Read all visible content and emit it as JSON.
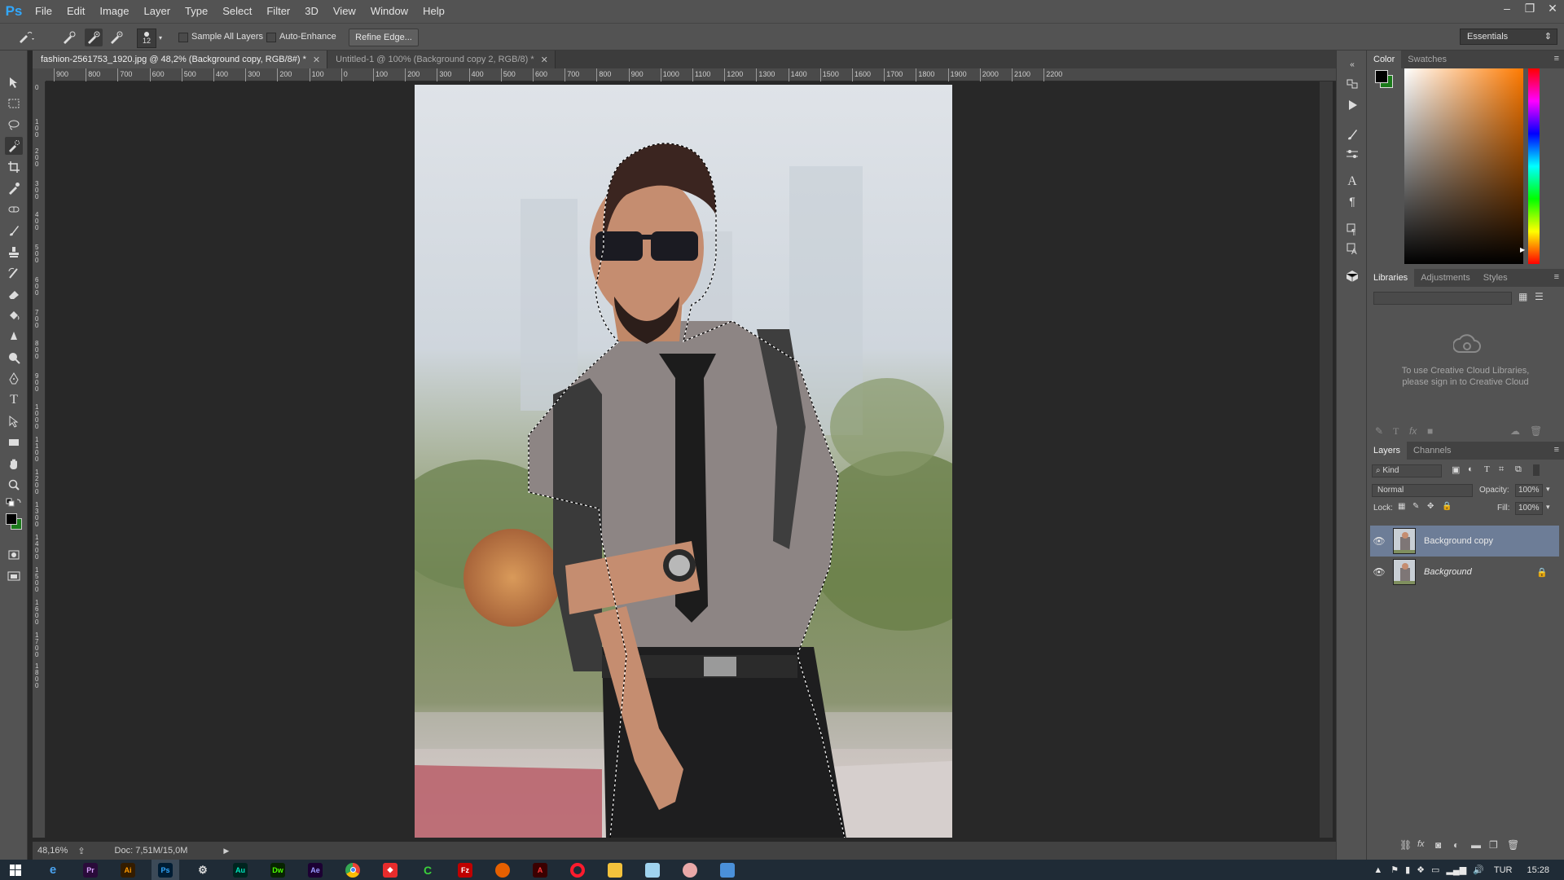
{
  "app": {
    "logo_text": "Ps",
    "menu": [
      "File",
      "Edit",
      "Image",
      "Layer",
      "Type",
      "Select",
      "Filter",
      "3D",
      "View",
      "Window",
      "Help"
    ],
    "window_controls": [
      "–",
      "❐",
      "✕"
    ]
  },
  "options_bar": {
    "brush_size": "12",
    "sample_all_layers_label": "Sample All Layers",
    "auto_enhance_label": "Auto-Enhance",
    "refine_edge_label": "Refine Edge...",
    "workspace": "Essentials"
  },
  "documents": [
    {
      "title": "fashion-2561753_1920.jpg @ 48,2% (Background copy, RGB/8#) *",
      "active": true
    },
    {
      "title": "Untitled-1 @ 100% (Background copy 2, RGB/8) *",
      "active": false
    }
  ],
  "ruler": {
    "top_labels": [
      "900",
      "800",
      "700",
      "600",
      "500",
      "400",
      "300",
      "200",
      "100",
      "0",
      "100",
      "200",
      "300",
      "400",
      "500",
      "600",
      "700",
      "800",
      "900",
      "1000",
      "1100",
      "1200",
      "1300",
      "1400",
      "1500",
      "1600",
      "1700",
      "1800",
      "1900",
      "2000",
      "2100",
      "2200"
    ]
  },
  "status": {
    "zoom": "48,16%",
    "doc_size": "Doc: 7,51M/15,0M"
  },
  "color_panel": {
    "tabs": [
      "Color",
      "Swatches"
    ],
    "foreground": "#000000",
    "background": "#1a7a1a"
  },
  "libraries_panel": {
    "tabs": [
      "Libraries",
      "Adjustments",
      "Styles"
    ],
    "message_line1": "To use Creative Cloud Libraries,",
    "message_line2": "please sign in to Creative Cloud"
  },
  "layers_panel": {
    "tabs": [
      "Layers",
      "Channels"
    ],
    "filter_kind": "Kind",
    "blend_mode": "Normal",
    "opacity_label": "Opacity:",
    "opacity_value": "100%",
    "lock_label": "Lock:",
    "fill_label": "Fill:",
    "fill_value": "100%",
    "layers": [
      {
        "name": "Background copy",
        "selected": true,
        "locked": false
      },
      {
        "name": "Background",
        "selected": false,
        "locked": true
      }
    ]
  },
  "taskbar": {
    "apps": [
      "IE",
      "Pr",
      "Ai",
      "Ps",
      "Settings",
      "Au",
      "Dw",
      "Ae",
      "Chrome",
      "App",
      "Camtasia",
      "FileZilla",
      "Firefox",
      "Acrobat",
      "Opera",
      "Explorer",
      "Notepad",
      "Paint",
      "Window"
    ],
    "language": "TUR",
    "time": "15:28"
  }
}
